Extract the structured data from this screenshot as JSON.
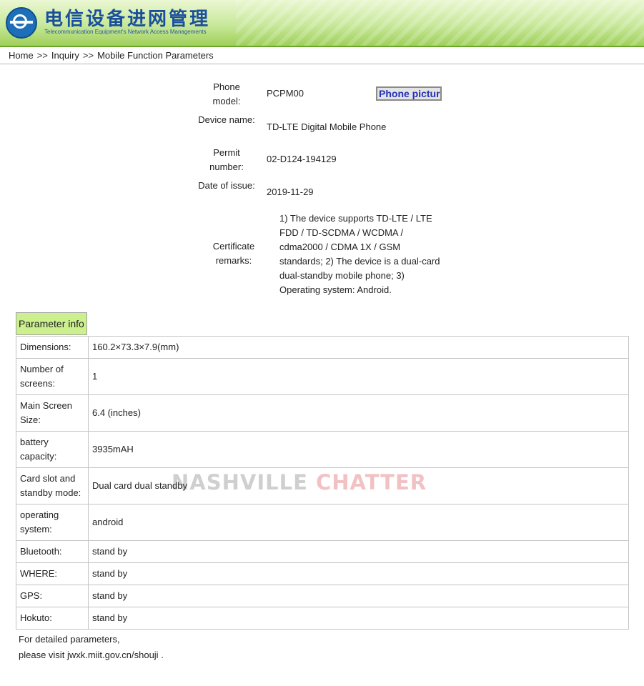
{
  "header": {
    "title": "电信设备进网管理",
    "subtitle": "Telecommunication Equipment's Network Access Managements"
  },
  "breadcrumb": {
    "home": "Home",
    "sep": ">>",
    "inquiry": "Inquiry",
    "current": "Mobile Function Parameters"
  },
  "phone": {
    "model_label": "Phone model:",
    "model": "PCPM00",
    "picture_button": "Phone picture",
    "device_label": "Device name:",
    "device": "TD-LTE Digital Mobile Phone",
    "permit_label": "Permit number:",
    "permit": "02-D124-194129",
    "date_label": "Date of issue:",
    "date": "2019-11-29",
    "remarks_label": "Certificate remarks:",
    "remarks": "1) The device supports TD-LTE / LTE FDD / TD-SCDMA / WCDMA / cdma2000 / CDMA 1X / GSM standards; 2) The device is a dual-card dual-standby mobile phone; 3) Operating system: Android."
  },
  "params": {
    "header": "Parameter info",
    "rows": [
      {
        "key": "Dimensions:",
        "value": "160.2×73.3×7.9(mm)"
      },
      {
        "key": "Number of screens:",
        "value": "1"
      },
      {
        "key": "Main Screen Size:",
        "value": "6.4 (inches)"
      },
      {
        "key": "battery capacity:",
        "value": "3935mAH"
      },
      {
        "key": "Card slot and standby mode:",
        "value": "Dual card dual standby"
      },
      {
        "key": "operating system:",
        "value": "android"
      },
      {
        "key": "Bluetooth:",
        "value": "stand by"
      },
      {
        "key": "WHERE:",
        "value": "stand by"
      },
      {
        "key": "GPS:",
        "value": "stand by"
      },
      {
        "key": "Hokuto:",
        "value": "stand by"
      }
    ]
  },
  "footer": {
    "line1": "For detailed parameters,",
    "line2_prefix": "please visit",
    "link": "jwxk.miit.gov.cn/shouji",
    "line2_suffix": "."
  },
  "watermark": {
    "part1": "NASHVILLE",
    "part2": "CHATTER"
  },
  "icons": {
    "logo": "telecom-logo-icon"
  },
  "colors": {
    "banner_green": "#9fd05a",
    "param_header_bg": "#cdf08e",
    "button_text": "#2330b5",
    "watermark_red": "#d0262d"
  }
}
